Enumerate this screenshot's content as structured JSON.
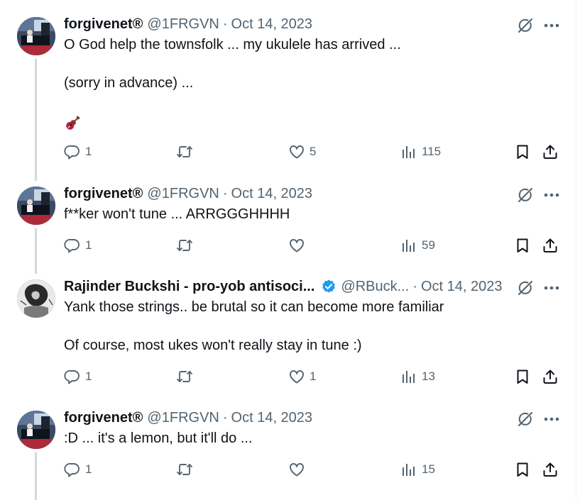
{
  "colors": {
    "text": "#0f1419",
    "muted": "#536471",
    "verified": "#1d9bf0",
    "thread_line": "#cfd9de",
    "guitar": "#b3213a"
  },
  "icons": [
    "avatar",
    "grok-icon",
    "more-icon",
    "reply-icon",
    "repost-icon",
    "like-icon",
    "views-icon",
    "bookmark-icon",
    "share-icon",
    "guitar-emoji",
    "verified-badge-icon"
  ],
  "tweets": [
    {
      "name": "forgivenet®",
      "handle": "@1FRGVN",
      "sep": "·",
      "date": "Oct 14, 2023",
      "text": "O God help the townsfolk ... my ukulele has arrived ...\n\n(sorry in advance) ...",
      "replies": "1",
      "reposts": "",
      "likes": "5",
      "views": "115"
    },
    {
      "name": "forgivenet®",
      "handle": "@1FRGVN",
      "sep": "·",
      "date": "Oct 14, 2023",
      "text": "f**ker won't tune ... ARRGGGHHHH",
      "replies": "1",
      "reposts": "",
      "likes": "",
      "views": "59"
    },
    {
      "name": "Rajinder Buckshi - pro-yob antisoci...",
      "handle": "@RBuck...",
      "sep": "·",
      "date": "Oct 14, 2023",
      "text": "Yank those strings.. be brutal so it can become more familiar\n\nOf course, most ukes won't really stay in tune :)",
      "replies": "1",
      "reposts": "",
      "likes": "1",
      "views": "13"
    },
    {
      "name": "forgivenet®",
      "handle": "@1FRGVN",
      "sep": "·",
      "date": "Oct 14, 2023",
      "text": ":D ... it's a lemon, but it'll do ...",
      "replies": "1",
      "reposts": "",
      "likes": "",
      "views": "15"
    }
  ]
}
